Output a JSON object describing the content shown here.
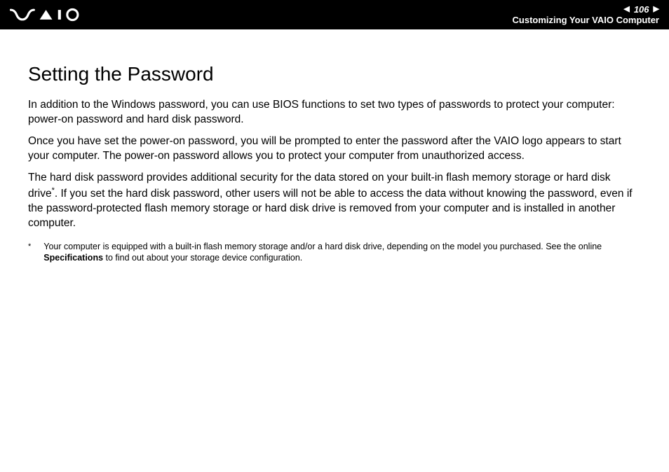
{
  "header": {
    "page_number": "106",
    "subtitle": "Customizing Your VAIO Computer"
  },
  "content": {
    "title": "Setting the Password",
    "para1": "In addition to the Windows password, you can use BIOS functions to set two types of passwords to protect your computer: power-on password and hard disk password.",
    "para2": "Once you have set the power-on password, you will be prompted to enter the password after the VAIO logo appears to start your computer. The power-on password allows you to protect your computer from unauthorized access.",
    "para3_a": "The hard disk password provides additional security for the data stored on your built-in flash memory storage or hard disk drive",
    "para3_sup": "*",
    "para3_b": ". If you set the hard disk password, other users will not be able to access the data without knowing the password, even if the password-protected flash memory storage or hard disk drive is removed from your computer and is installed in another computer.",
    "footnote_marker": "*",
    "footnote_a": "Your computer is equipped with a built-in flash memory storage and/or a hard disk drive, depending on the model you purchased. See the online ",
    "footnote_bold": "Specifications",
    "footnote_b": " to find out about your storage device configuration."
  }
}
